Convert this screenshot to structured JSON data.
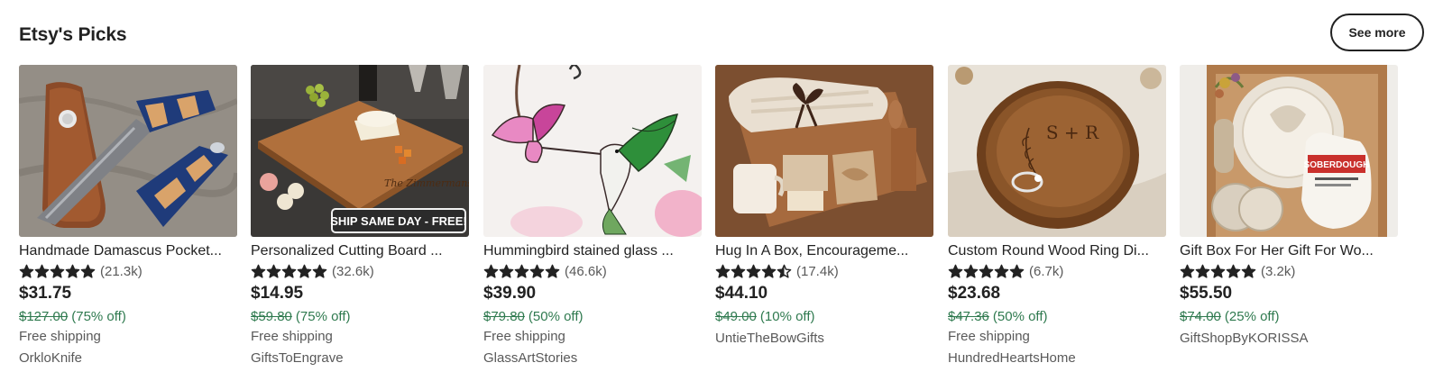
{
  "section": {
    "title": "Etsy's Picks",
    "see_more_label": "See more"
  },
  "colors": {
    "discount": "#2f7a4f",
    "muted": "#595959",
    "star": "#222222"
  },
  "products": [
    {
      "title": "Handmade Damascus Pocket...",
      "rating": 5.0,
      "reviews": "(21.3k)",
      "price": "$31.75",
      "original_price": "$127.00",
      "discount": "(75% off)",
      "shipping": "Free shipping",
      "shop": "OrkloKnife",
      "image_icon": "folding-knife-image"
    },
    {
      "title": "Personalized Cutting Board ...",
      "rating": 5.0,
      "reviews": "(32.6k)",
      "price": "$14.95",
      "original_price": "$59.80",
      "discount": "(75% off)",
      "shipping": "Free shipping",
      "shop": "GiftsToEngrave",
      "image_icon": "cutting-board-image",
      "badge": "SHIP SAME DAY - FREE!",
      "engraving": "The Zimmermans"
    },
    {
      "title": "Hummingbird stained glass ...",
      "rating": 5.0,
      "reviews": "(46.6k)",
      "price": "$39.90",
      "original_price": "$79.80",
      "discount": "(50% off)",
      "shipping": "Free shipping",
      "shop": "GlassArtStories",
      "image_icon": "hummingbird-suncatcher-image"
    },
    {
      "title": "Hug In A Box, Encourageme...",
      "rating": 4.5,
      "reviews": "(17.4k)",
      "price": "$44.10",
      "original_price": "$49.00",
      "discount": "(10% off)",
      "shipping": "",
      "shop": "UntieTheBowGifts",
      "image_icon": "gift-box-image"
    },
    {
      "title": "Custom Round Wood Ring Di...",
      "rating": 5.0,
      "reviews": "(6.7k)",
      "price": "$23.68",
      "original_price": "$47.36",
      "discount": "(50% off)",
      "shipping": "Free shipping",
      "shop": "HundredHeartsHome",
      "image_icon": "ring-dish-image",
      "engraving": "S + R"
    },
    {
      "title": "Gift Box For Her Gift For Wo...",
      "rating": 5.0,
      "reviews": "(3.2k)",
      "price": "$55.50",
      "original_price": "$74.00",
      "discount": "(25% off)",
      "shipping": "",
      "shop": "GiftShopByKORISSA",
      "image_icon": "gift-box-sourdough-image",
      "label_text": "SOBERDOUGH"
    }
  ]
}
